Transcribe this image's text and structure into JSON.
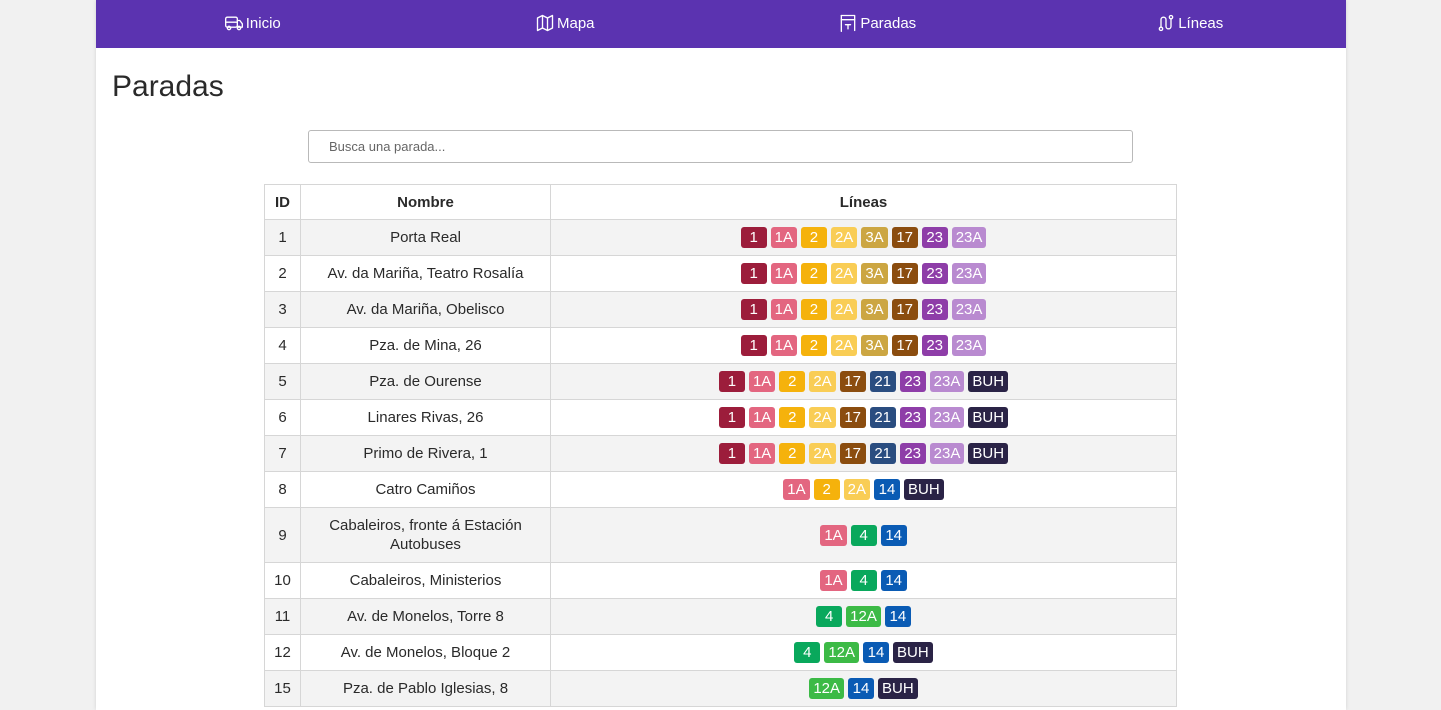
{
  "nav": {
    "items": [
      {
        "label": "Inicio",
        "icon": "bus-icon"
      },
      {
        "label": "Mapa",
        "icon": "map-icon"
      },
      {
        "label": "Paradas",
        "icon": "bus-stop-icon"
      },
      {
        "label": "Líneas",
        "icon": "route-icon"
      }
    ]
  },
  "page": {
    "title": "Paradas",
    "search_placeholder": "Busca una parada..."
  },
  "table": {
    "headers": [
      "ID",
      "Nombre",
      "Líneas"
    ],
    "rows": [
      {
        "id": "1",
        "name": "Porta Real",
        "lines": [
          "1",
          "1A",
          "2",
          "2A",
          "3A",
          "17",
          "23",
          "23A"
        ]
      },
      {
        "id": "2",
        "name": "Av. da Mariña, Teatro Rosalía",
        "lines": [
          "1",
          "1A",
          "2",
          "2A",
          "3A",
          "17",
          "23",
          "23A"
        ]
      },
      {
        "id": "3",
        "name": "Av. da Mariña, Obelisco",
        "lines": [
          "1",
          "1A",
          "2",
          "2A",
          "3A",
          "17",
          "23",
          "23A"
        ]
      },
      {
        "id": "4",
        "name": "Pza. de Mina, 26",
        "lines": [
          "1",
          "1A",
          "2",
          "2A",
          "3A",
          "17",
          "23",
          "23A"
        ]
      },
      {
        "id": "5",
        "name": "Pza. de Ourense",
        "lines": [
          "1",
          "1A",
          "2",
          "2A",
          "17",
          "21",
          "23",
          "23A",
          "BUH"
        ]
      },
      {
        "id": "6",
        "name": "Linares Rivas, 26",
        "lines": [
          "1",
          "1A",
          "2",
          "2A",
          "17",
          "21",
          "23",
          "23A",
          "BUH"
        ]
      },
      {
        "id": "7",
        "name": "Primo de Rivera, 1",
        "lines": [
          "1",
          "1A",
          "2",
          "2A",
          "17",
          "21",
          "23",
          "23A",
          "BUH"
        ]
      },
      {
        "id": "8",
        "name": "Catro Camiños",
        "lines": [
          "1A",
          "2",
          "2A",
          "14",
          "BUH"
        ]
      },
      {
        "id": "9",
        "name": "Cabaleiros, fronte á Estación Autobuses",
        "lines": [
          "1A",
          "4",
          "14"
        ]
      },
      {
        "id": "10",
        "name": "Cabaleiros, Ministerios",
        "lines": [
          "1A",
          "4",
          "14"
        ]
      },
      {
        "id": "11",
        "name": "Av. de Monelos, Torre 8",
        "lines": [
          "4",
          "12A",
          "14"
        ]
      },
      {
        "id": "12",
        "name": "Av. de Monelos, Bloque 2",
        "lines": [
          "4",
          "12A",
          "14",
          "BUH"
        ]
      },
      {
        "id": "15",
        "name": "Pza. de Pablo Iglesias, 8",
        "lines": [
          "12A",
          "14",
          "BUH"
        ]
      }
    ]
  },
  "line_colors": {
    "1": "#9c1d3b",
    "1A": "#e36680",
    "2": "#f5b20c",
    "2A": "#f9cd55",
    "3A": "#cca642",
    "12A": "#3cba46",
    "14": "#0a5bb4",
    "17": "#8b4d0f",
    "21": "#2a4d80",
    "23": "#8e3da8",
    "23A": "#b98ad0",
    "4": "#09a85c",
    "BUH": "#2a2346"
  },
  "colors": {
    "nav_background": "#5b33b0"
  }
}
